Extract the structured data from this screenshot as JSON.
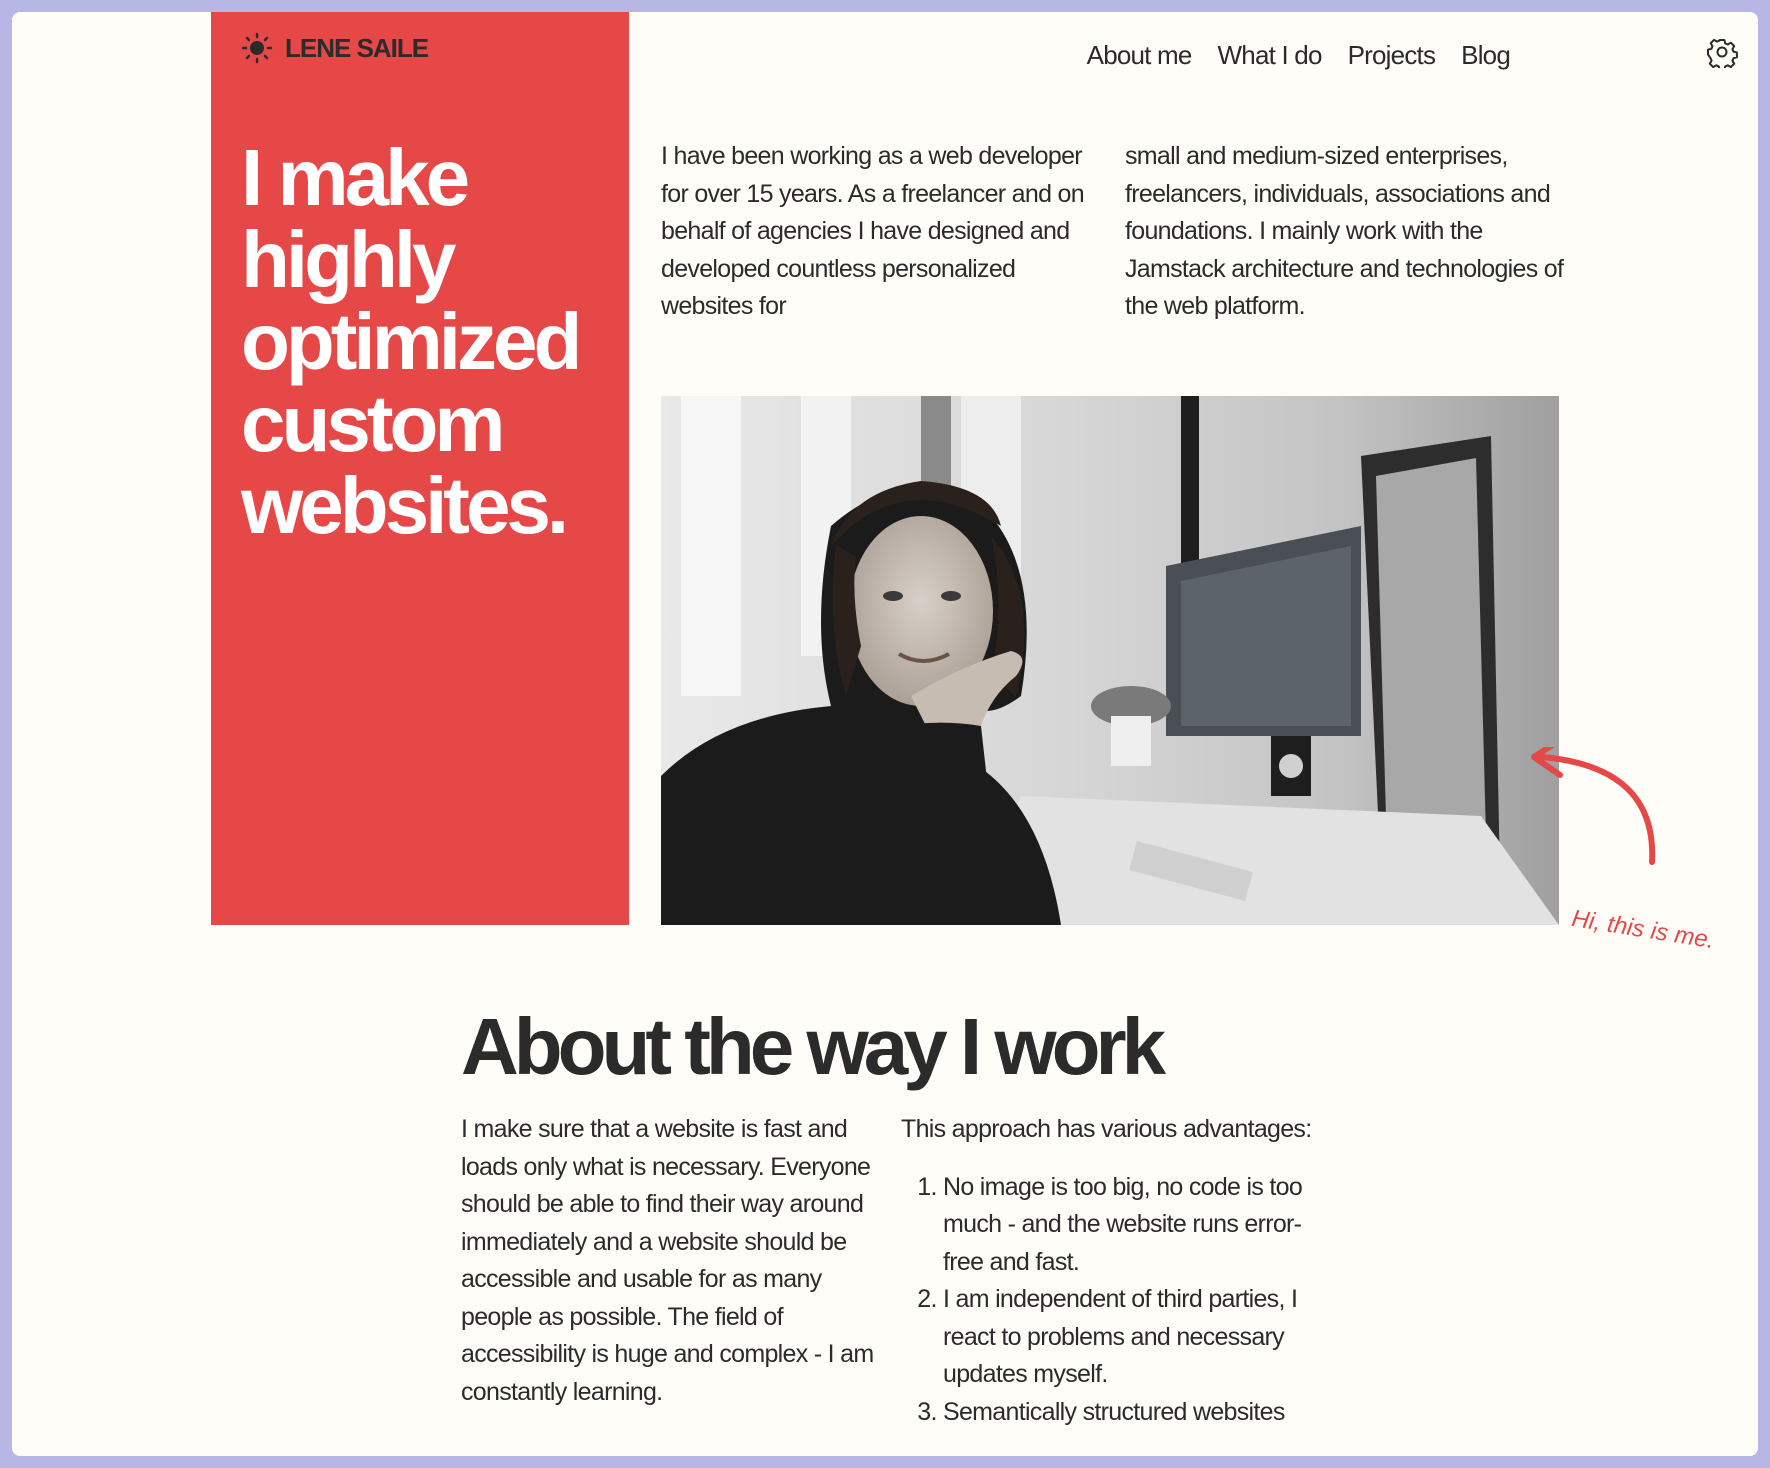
{
  "brand": {
    "name": "LENE SAILE"
  },
  "nav": {
    "items": [
      "About me",
      "What I do",
      "Projects",
      "Blog"
    ]
  },
  "hero": {
    "title": "I make highly optimized custom websites."
  },
  "intro": {
    "left": "I have been working as a web developer for over 15 years. As a freelancer and on behalf of agencies I have designed and developed countless personalized websites for",
    "right": "small and medium-sized enterprises, freelancers, individuals, associations and foundations. I mainly work with the Jamstack architecture and technologies of the web platform."
  },
  "photo": {
    "callout": "Hi, this is me."
  },
  "about": {
    "title": "About the way I work",
    "left": "I make sure that a website is fast and loads only what is necessary. Everyone should be able to find their way around immediately and a website should be accessible and usable for as many people as possible. The field of accessibility is huge and complex - I am constantly learning.",
    "right_intro": "This approach has various advantages:",
    "advantages": [
      "No image is too big, no code is too much - and the website runs error-free and fast.",
      "I am independent of third parties, I react to problems and necessary updates myself.",
      "Semantically structured websites"
    ]
  },
  "colors": {
    "accent": "#e64848",
    "background": "#fefdf8",
    "text": "#2b2b2b",
    "frame": "#b8b6e4"
  },
  "icons": {
    "logo": "sun-icon",
    "settings": "gear-icon"
  }
}
